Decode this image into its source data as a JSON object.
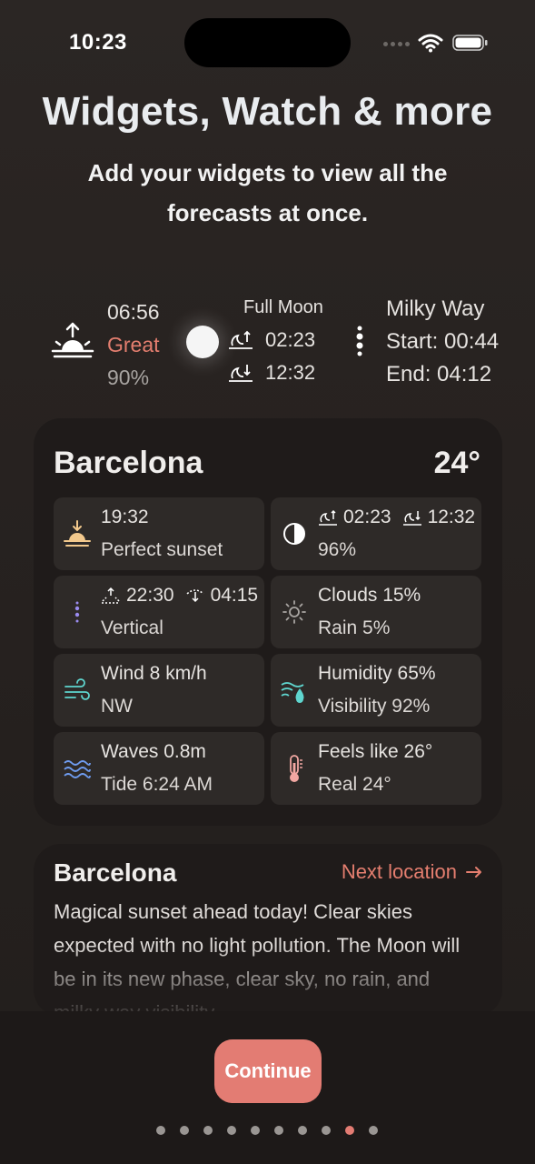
{
  "status": {
    "time": "10:23"
  },
  "header": {
    "title": "Widgets, Watch & more",
    "subtitle": "Add your widgets to view all the forecasts at once."
  },
  "summary": {
    "sunrise": {
      "time": "06:56",
      "rating": "Great",
      "percent": "90%"
    },
    "moon": {
      "phase": "Full Moon",
      "rise": "02:23",
      "set": "12:32"
    },
    "milky_way": {
      "title": "Milky Way",
      "start": "Start: 00:44",
      "end": "End: 04:12"
    }
  },
  "card": {
    "city": "Barcelona",
    "temperature": "24°",
    "tiles": [
      {
        "icon": "sunset-icon",
        "line1": "19:32",
        "line2": "Perfect sunset"
      },
      {
        "icon": "moon-half-icon",
        "rise": "02:23",
        "set": "12:32",
        "line2": "96%"
      },
      {
        "icon": "milky-way-icon",
        "rise": "22:30",
        "set": "04:15",
        "line2": "Vertical"
      },
      {
        "icon": "sun-outline-icon",
        "line1": "Clouds 15%",
        "line2": "Rain 5%"
      },
      {
        "icon": "wind-icon",
        "line1": "Wind 8 km/h",
        "line2": "NW"
      },
      {
        "icon": "humidity-icon",
        "line1": "Humidity 65%",
        "line2": "Visibility 92%"
      },
      {
        "icon": "waves-icon",
        "line1": "Waves 0.8m",
        "line2": "Tide 6:24 AM"
      },
      {
        "icon": "thermometer-icon",
        "line1": "Feels like 26°",
        "line2": "Real 24°"
      }
    ]
  },
  "description": {
    "city": "Barcelona",
    "next_label": "Next location",
    "text": "Magical sunset ahead today! Clear skies expected with no light pollution. The Moon will be in its new phase, clear sky, no rain, and milky way visibility."
  },
  "footer": {
    "continue_label": "Continue",
    "page_count": 10,
    "active_page": 8
  },
  "colors": {
    "accent": "#e37c73",
    "background": "#272220",
    "card": "#1f1b1a",
    "tile": "#2e2a28"
  }
}
